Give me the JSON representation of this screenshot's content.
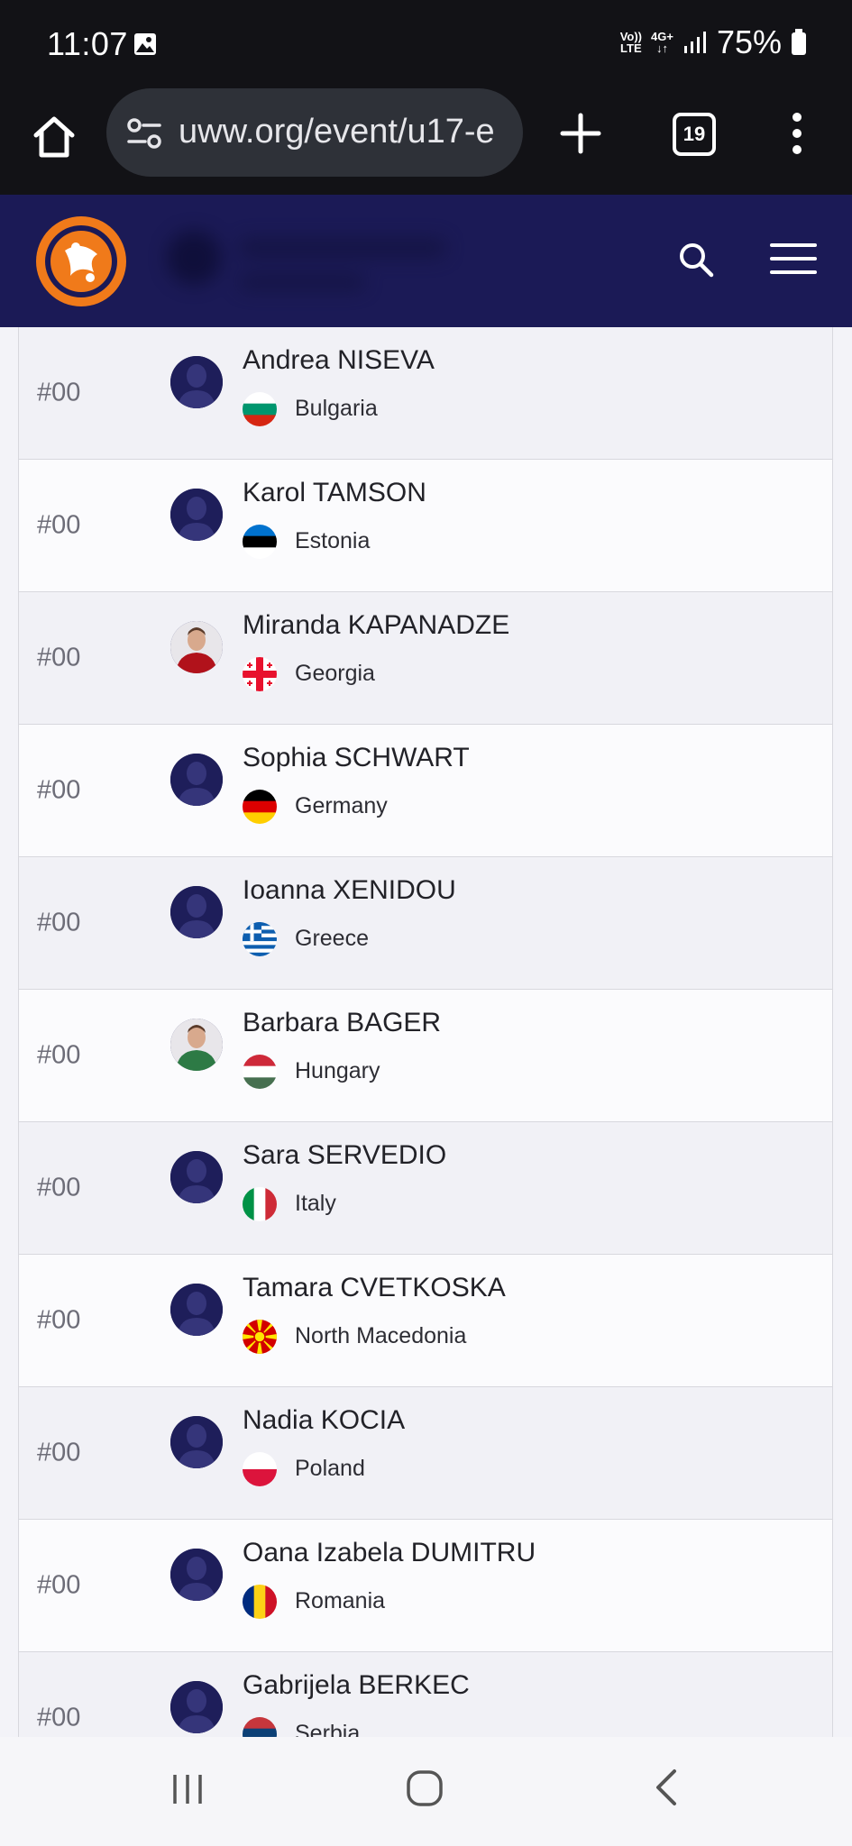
{
  "status_bar": {
    "time": "11:07",
    "network_top": "Vo))",
    "network_bottom": "LTE",
    "data_type_top": "4G+",
    "data_type_bottom": "↓↑",
    "battery": "75%"
  },
  "browser": {
    "url": "uww.org/event/u17-e",
    "tab_count": "19"
  },
  "athletes": [
    {
      "seed": "#00",
      "name": "Andrea NISEVA",
      "country": "Bulgaria",
      "flag": "bulgaria",
      "has_photo": false
    },
    {
      "seed": "#00",
      "name": "Karol TAMSON",
      "country": "Estonia",
      "flag": "estonia",
      "has_photo": false
    },
    {
      "seed": "#00",
      "name": "Miranda KAPANADZE",
      "country": "Georgia",
      "flag": "georgia",
      "has_photo": true
    },
    {
      "seed": "#00",
      "name": "Sophia SCHWART",
      "country": "Germany",
      "flag": "germany",
      "has_photo": false
    },
    {
      "seed": "#00",
      "name": "Ioanna XENIDOU",
      "country": "Greece",
      "flag": "greece",
      "has_photo": false
    },
    {
      "seed": "#00",
      "name": "Barbara BAGER",
      "country": "Hungary",
      "flag": "hungary",
      "has_photo": true
    },
    {
      "seed": "#00",
      "name": "Sara SERVEDIO",
      "country": "Italy",
      "flag": "italy",
      "has_photo": false
    },
    {
      "seed": "#00",
      "name": "Tamara CVETKOSKA",
      "country": "North Macedonia",
      "flag": "north-macedonia",
      "has_photo": false
    },
    {
      "seed": "#00",
      "name": "Nadia KOCIA",
      "country": "Poland",
      "flag": "poland",
      "has_photo": false
    },
    {
      "seed": "#00",
      "name": "Oana Izabela DUMITRU",
      "country": "Romania",
      "flag": "romania",
      "has_photo": false
    },
    {
      "seed": "#00",
      "name": "Gabrijela BERKEC",
      "country": "Serbia",
      "flag": "serbia",
      "has_photo": false
    }
  ],
  "colors": {
    "header_bg": "#1b1a56",
    "logo_orange": "#f07a1a",
    "status_bg": "#121216"
  },
  "icons": {
    "home": "home-icon",
    "site_info": "tune-icon",
    "new_tab": "plus-icon",
    "overflow": "more-vert-icon",
    "search": "search-icon",
    "menu": "hamburger-icon",
    "nav_recents": "recents-icon",
    "nav_home": "home-circle-icon",
    "nav_back": "back-chevron-icon"
  }
}
